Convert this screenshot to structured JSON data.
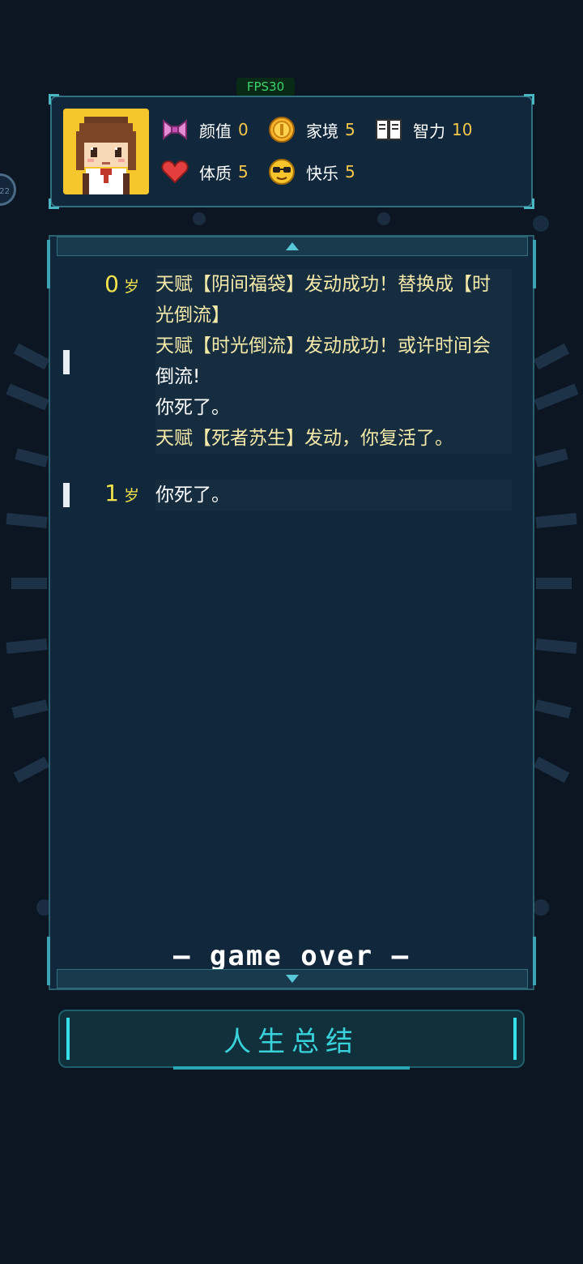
{
  "fps": "FPS30",
  "side_bubble": "22",
  "stats": [
    {
      "label": "颜值",
      "value": "0",
      "icon": "bow-icon"
    },
    {
      "label": "家境",
      "value": "5",
      "icon": "coin-icon"
    },
    {
      "label": "智力",
      "value": "10",
      "icon": "book-icon"
    },
    {
      "label": "体质",
      "value": "5",
      "icon": "heart-icon"
    },
    {
      "label": "快乐",
      "value": "5",
      "icon": "sunglasses-emoji-icon"
    }
  ],
  "log": [
    {
      "age": "0",
      "unit": "岁",
      "lines": [
        {
          "text": "天赋【阴间福袋】发动成功！替换成【时",
          "color": "yellow"
        },
        {
          "text": "光倒流】",
          "color": "yellow"
        },
        {
          "text": "天赋【时光倒流】发动成功！或许时间会",
          "color": "yellow"
        },
        {
          "text": "倒流!",
          "color": "white"
        },
        {
          "text": "你死了。",
          "color": "white"
        },
        {
          "text": "天赋【死者苏生】发动，你复活了。",
          "color": "yellow"
        }
      ]
    },
    {
      "age": "1",
      "unit": "岁",
      "lines": [
        {
          "text": "你死了。",
          "color": "white"
        }
      ]
    }
  ],
  "game_over": "— game over —",
  "summary_button": "人生总结",
  "colors": {
    "background": "#0b1622",
    "panel": "#11283c",
    "accent": "#39d2da",
    "age": "#f3e24b",
    "stat_value": "#f5c84a"
  }
}
